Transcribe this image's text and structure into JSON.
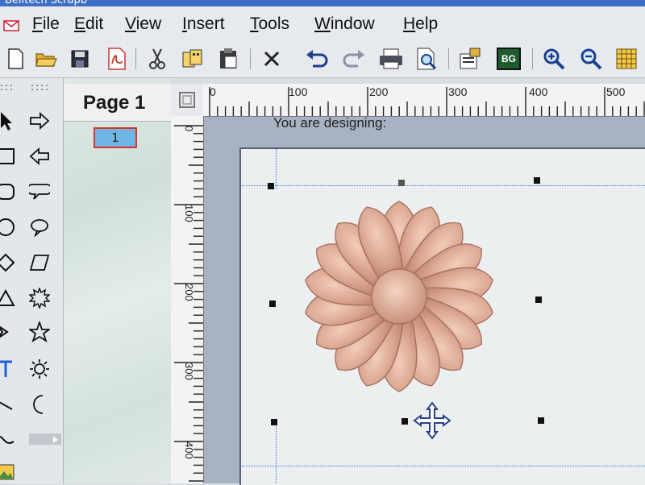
{
  "window": {
    "title": "Belltech Scrapb"
  },
  "menu": [
    {
      "label": "File"
    },
    {
      "label": "Edit"
    },
    {
      "label": "View"
    },
    {
      "label": "Insert"
    },
    {
      "label": "Tools"
    },
    {
      "label": "Window"
    },
    {
      "label": "Help"
    }
  ],
  "toolbar": {
    "bg_label": "BG",
    "buttons": [
      "new-icon",
      "open-icon",
      "save-icon",
      "pdf-icon",
      "cut-icon",
      "copy-icon",
      "paste-icon",
      "delete-icon",
      "undo-icon",
      "redo-icon",
      "print-icon",
      "preview-icon",
      "properties-icon",
      "background-icon",
      "zoom-in-icon",
      "zoom-out-icon",
      "grid-icon"
    ]
  },
  "page_panel": {
    "title": "Page 1",
    "thumb_label": "1"
  },
  "ruler_top": {
    "labels": [
      "0",
      "100",
      "200",
      "300",
      "400",
      "500"
    ]
  },
  "ruler_left": {
    "labels": [
      "0",
      "100",
      "200",
      "300",
      "400"
    ]
  },
  "canvas": {
    "status_text": "You are designing:"
  },
  "colors": {
    "menubar_bg": "#e6e9ee",
    "accent_red": "#d9342b",
    "thumb_fill": "#6fb6e4",
    "guide_blue": "#3a6fd8",
    "flower": "#d9a590"
  }
}
